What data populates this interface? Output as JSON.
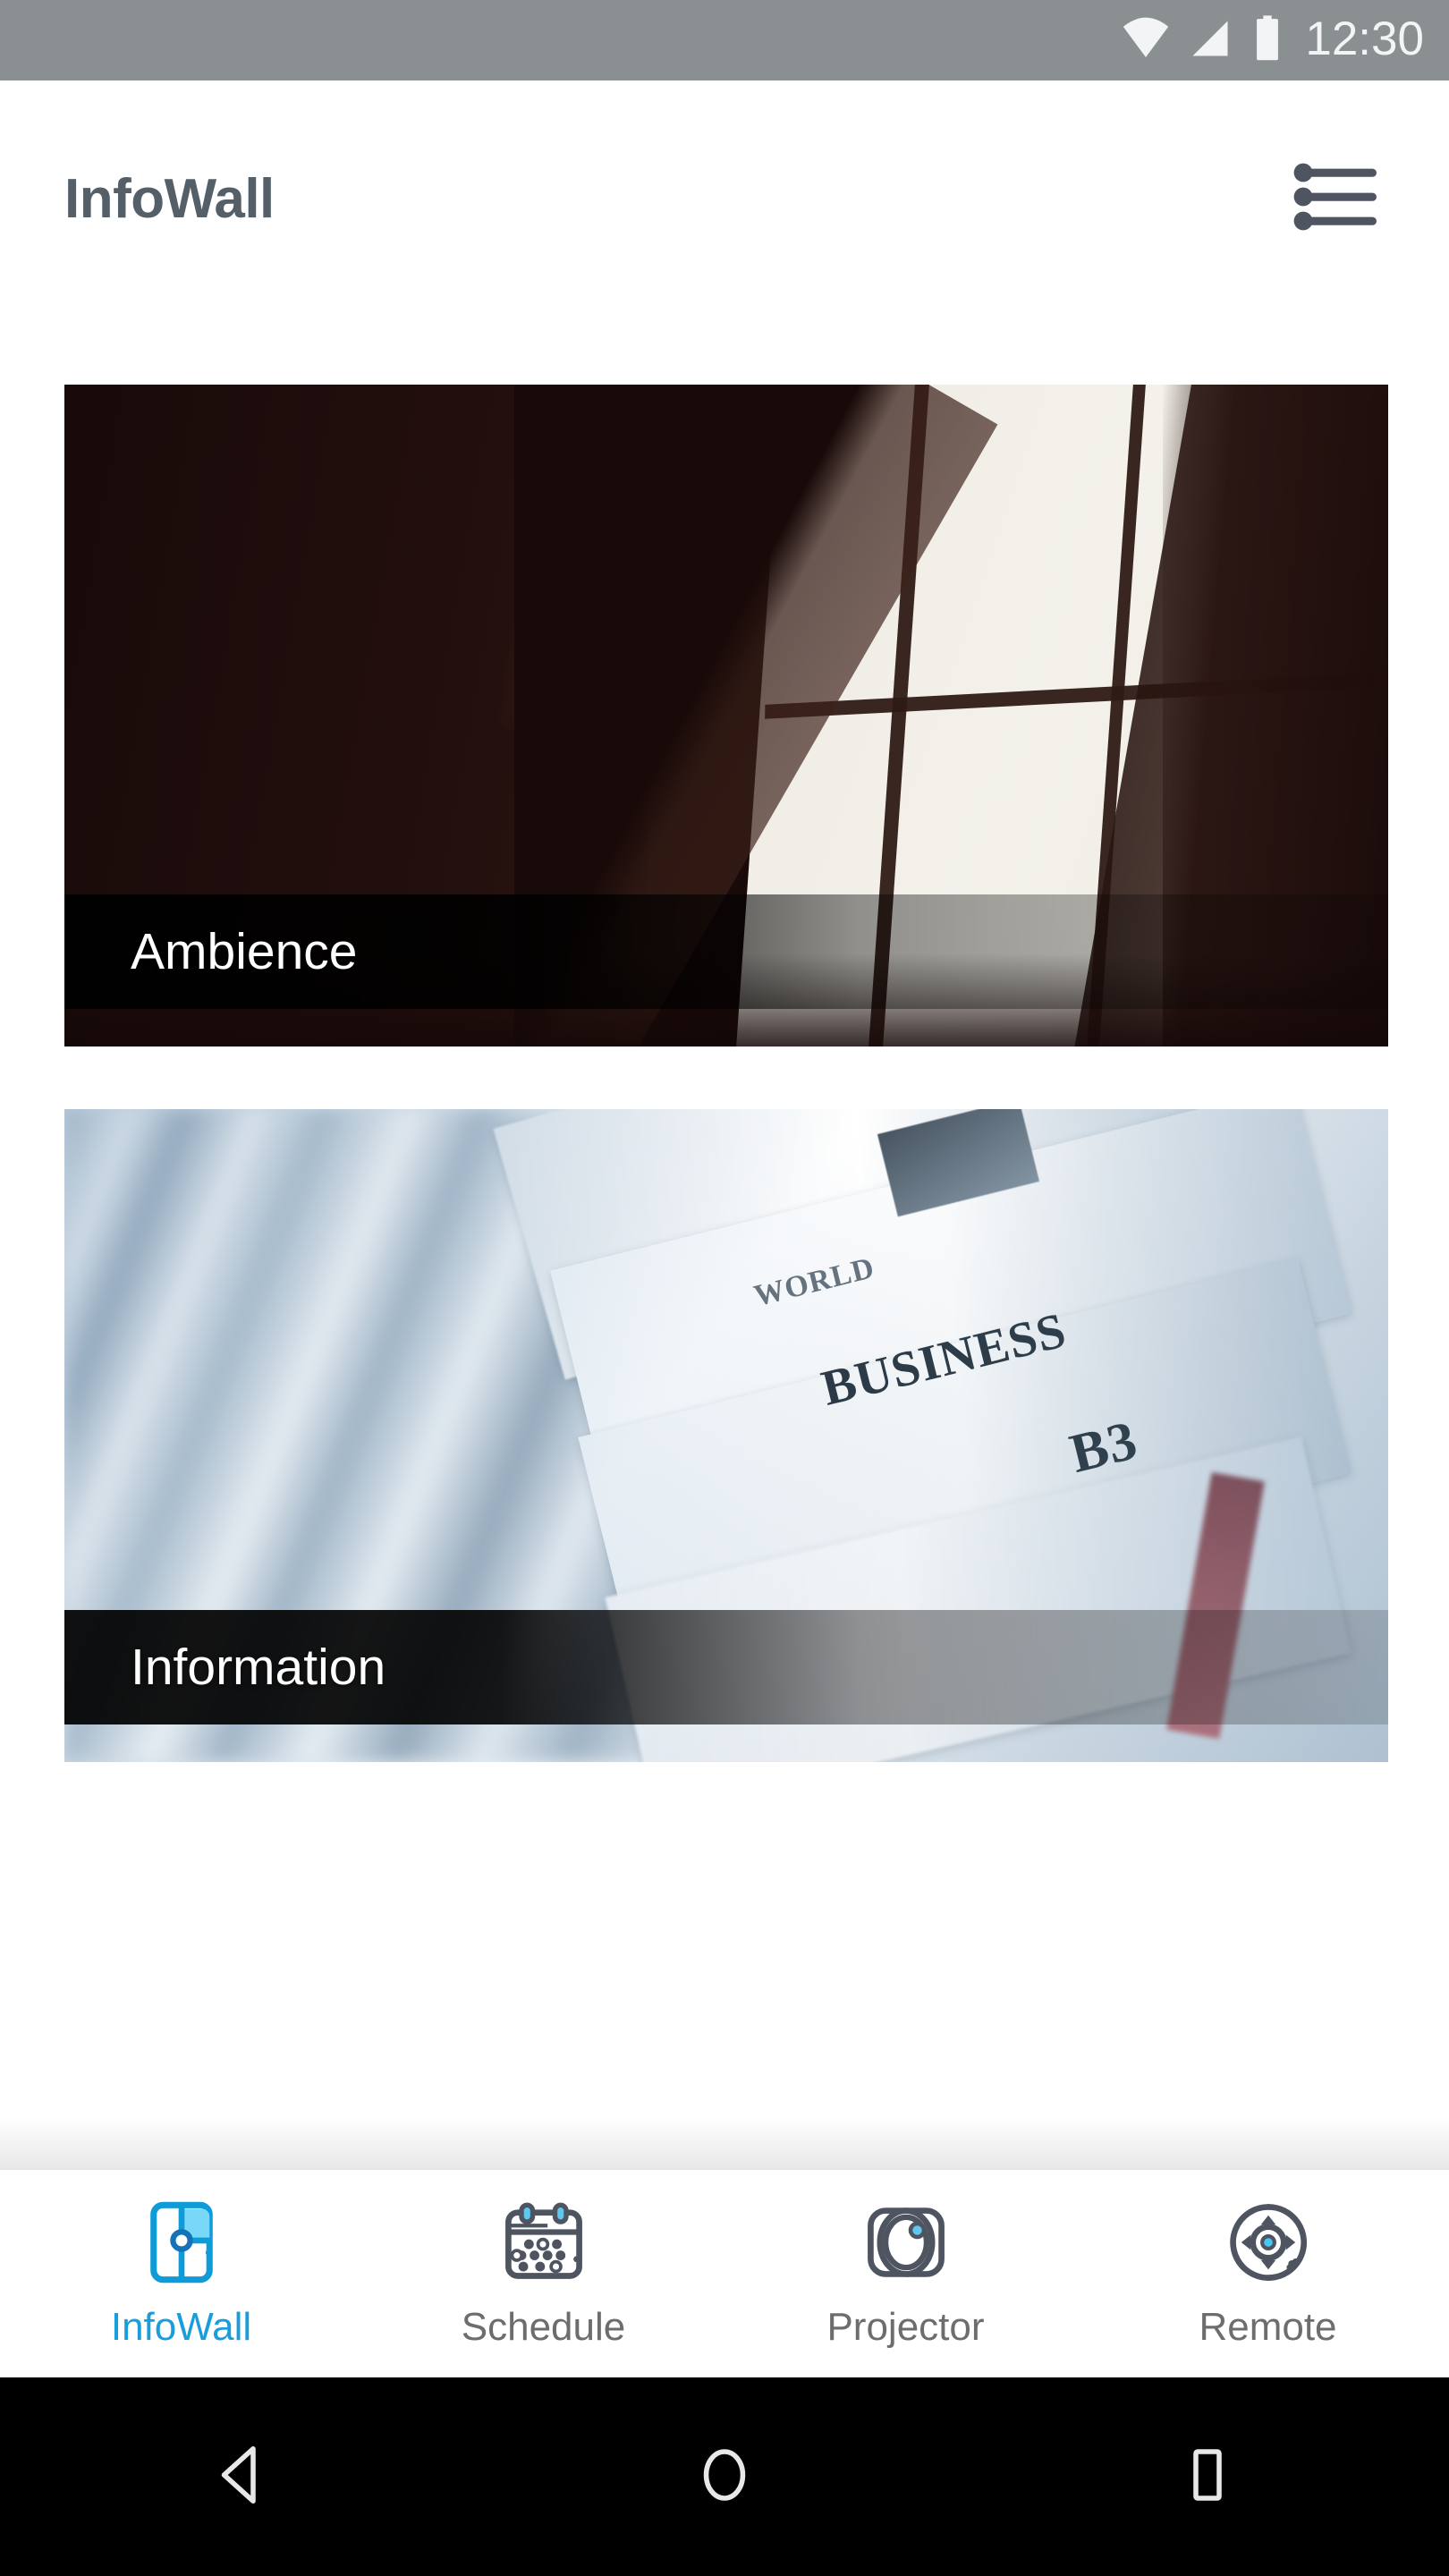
{
  "status_bar": {
    "time": "12:30",
    "icons": [
      "wifi-icon",
      "cellular-signal-icon",
      "battery-icon"
    ],
    "background_color": "#8a8f91",
    "foreground_color": "#f2f4f5"
  },
  "app_bar": {
    "title": "InfoWall",
    "menu_icon": "list-menu-icon",
    "title_color": "#555f68",
    "background_color": "#ffffff"
  },
  "cards": [
    {
      "id": "ambience",
      "label": "Ambience",
      "artwork": "dark-room-window-light-photo",
      "label_color": "#ffffff"
    },
    {
      "id": "information",
      "label": "Information",
      "artwork": "newspaper-stack-photo",
      "label_color": "#ffffff",
      "artwork_text": [
        "WORLD",
        "BUSINESS",
        "B3"
      ]
    }
  ],
  "bottom_nav": {
    "active_index": 0,
    "active_color": "#1a9ddb",
    "inactive_color": "#6d6d6d",
    "items": [
      {
        "label": "InfoWall",
        "icon": "infowall-panels-icon"
      },
      {
        "label": "Schedule",
        "icon": "calendar-icon"
      },
      {
        "label": "Projector",
        "icon": "projector-lens-icon"
      },
      {
        "label": "Remote",
        "icon": "remote-dpad-icon"
      }
    ]
  },
  "system_nav": {
    "background_color": "#000000",
    "buttons": [
      {
        "name": "back",
        "icon": "triangle-back-icon"
      },
      {
        "name": "home",
        "icon": "circle-home-icon"
      },
      {
        "name": "recents",
        "icon": "square-recents-icon"
      }
    ]
  }
}
